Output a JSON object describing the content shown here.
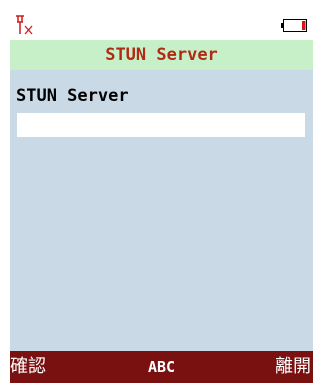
{
  "status": {
    "signal_icon": "no-signal-icon",
    "battery_icon": "battery-low-icon",
    "accent_color": "#d01818"
  },
  "title": "STUN Server",
  "form": {
    "label": "STUN Server",
    "value": ""
  },
  "softkeys": {
    "left": "確認",
    "center": "ABC",
    "right": "離開"
  },
  "colors": {
    "background": "#c9d9e5",
    "title_bar": "#c8f0c8",
    "title_text": "#b12a14",
    "softkey_bar": "#7a1111"
  }
}
